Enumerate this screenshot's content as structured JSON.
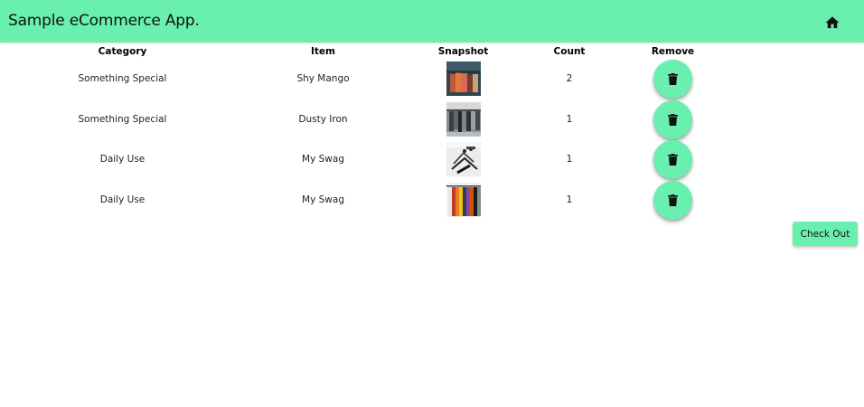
{
  "app": {
    "title": "Sample eCommerce App.",
    "accent_color": "#69f0ae",
    "home_icon": "home-icon"
  },
  "table": {
    "headers": {
      "category": "Category",
      "item": "Item",
      "snapshot": "Snapshot",
      "count": "Count",
      "remove": "Remove"
    },
    "rows": [
      {
        "category": "Something Special",
        "item": "Shy Mango",
        "count": "2",
        "snapshot_icon": "clothing-rack-photo"
      },
      {
        "category": "Something Special",
        "item": "Dusty Iron",
        "count": "1",
        "snapshot_icon": "clothing-store-photo"
      },
      {
        "category": "Daily Use",
        "item": "My Swag",
        "count": "1",
        "snapshot_icon": "hangers-photo"
      },
      {
        "category": "Daily Use",
        "item": "My Swag",
        "count": "1",
        "snapshot_icon": "colorful-shirts-photo"
      }
    ],
    "remove_icon": "trash-icon"
  },
  "actions": {
    "checkout_label": "Check Out"
  }
}
